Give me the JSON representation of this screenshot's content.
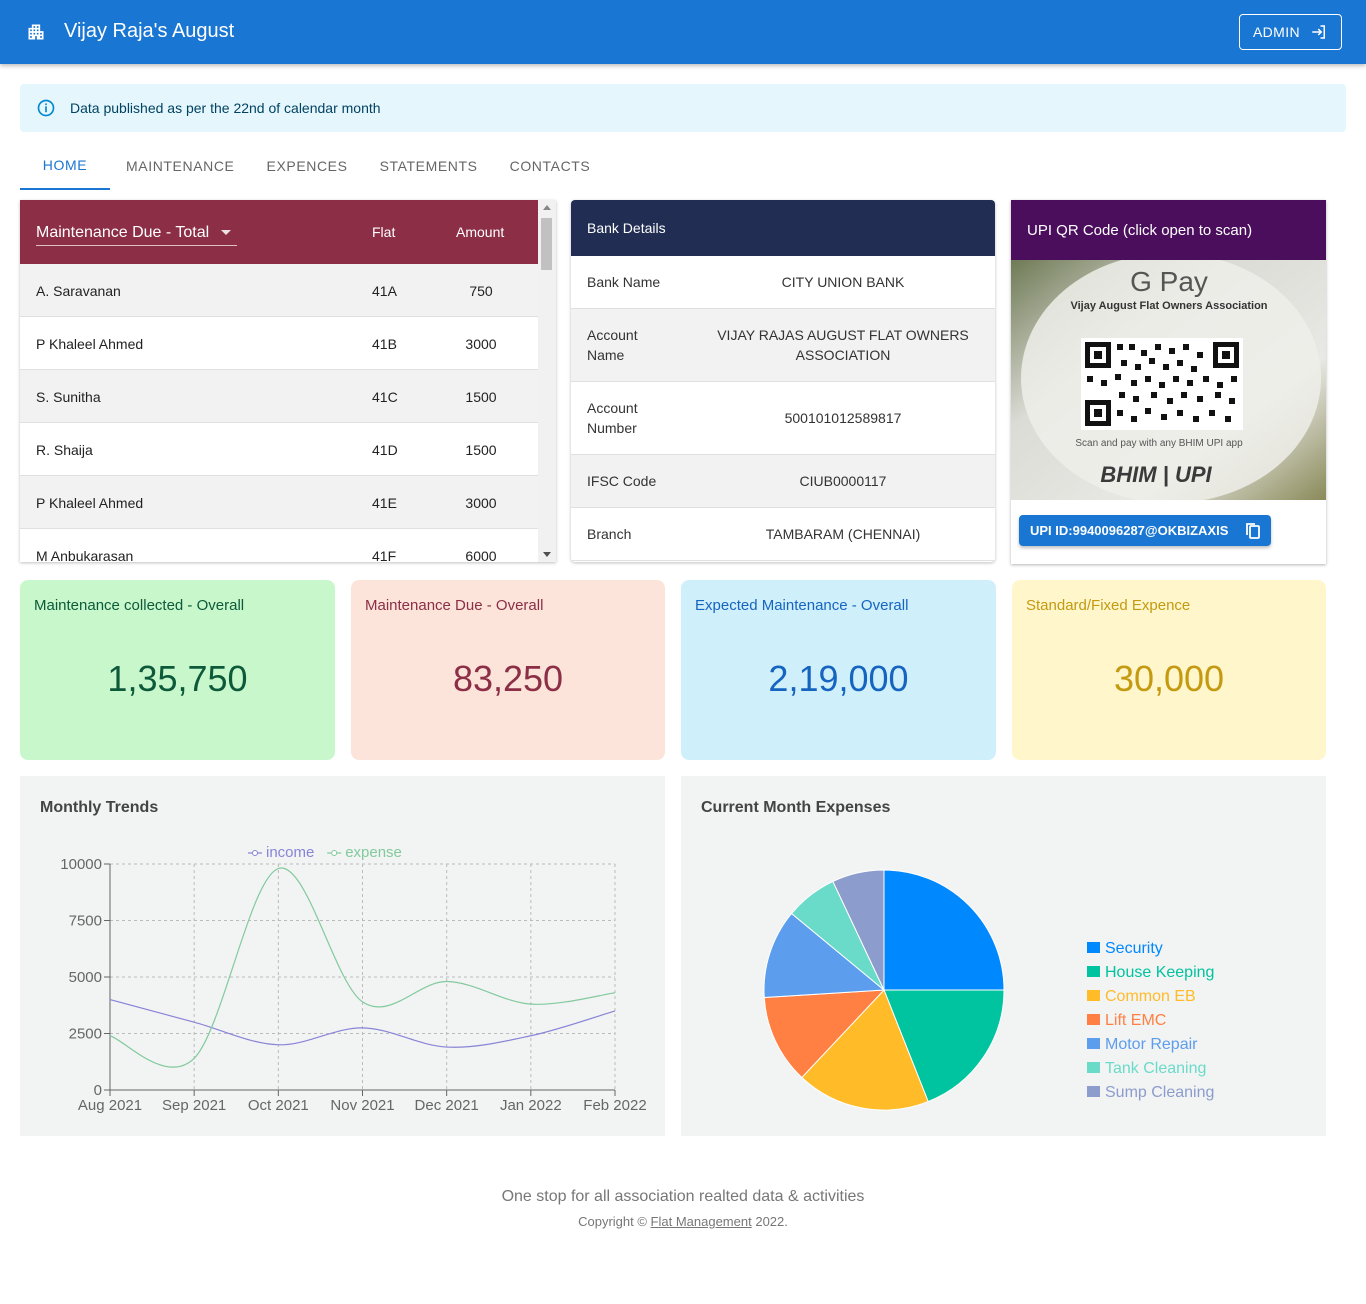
{
  "header": {
    "title": "Vijay Raja's August",
    "admin_label": "ADMIN"
  },
  "info": {
    "message": "Data published as per the 22nd of calendar month"
  },
  "tabs": [
    "HOME",
    "MAINTENANCE",
    "EXPENCES",
    "STATEMENTS",
    "CONTACTS"
  ],
  "due_table": {
    "selected": "Maintenance Due - Total",
    "col_flat": "Flat",
    "col_amount": "Amount",
    "rows": [
      {
        "name": "A. Saravanan",
        "flat": "41A",
        "amount": "750"
      },
      {
        "name": "P Khaleel Ahmed",
        "flat": "41B",
        "amount": "3000"
      },
      {
        "name": "S. Sunitha",
        "flat": "41C",
        "amount": "1500"
      },
      {
        "name": "R. Shaija",
        "flat": "41D",
        "amount": "1500"
      },
      {
        "name": "P Khaleel Ahmed",
        "flat": "41E",
        "amount": "3000"
      },
      {
        "name": "M Anbukarasan",
        "flat": "41F",
        "amount": "6000"
      }
    ]
  },
  "bank": {
    "title": "Bank Details",
    "rows": [
      {
        "key": "Bank Name",
        "value": "CITY UNION BANK"
      },
      {
        "key": "Account Name",
        "value": "VIJAY RAJAS AUGUST FLAT OWNERS ASSOCIATION"
      },
      {
        "key": "Account Number",
        "value": "500101012589817"
      },
      {
        "key": "IFSC Code",
        "value": "CIUB0000117"
      },
      {
        "key": "Branch",
        "value": "TAMBARAM (CHENNAI)"
      }
    ]
  },
  "upi": {
    "title": "UPI QR Code (click open to scan)",
    "button": "UPI ID:9940096287@OKBIZAXIS",
    "qr_brand": "G Pay",
    "qr_org": "Vijay August Flat Owners Association",
    "qr_caption": "Scan and pay with any BHIM UPI app",
    "qr_logo": "BHIM | UPI"
  },
  "stats": [
    {
      "label": "Maintenance collected - Overall",
      "value": "1,35,750",
      "bg": "#c8f7cc",
      "fg": "#0c5a3a"
    },
    {
      "label": "Maintenance Due - Overall",
      "value": "83,250",
      "bg": "#fde4da",
      "fg": "#8b2e46"
    },
    {
      "label": "Expected Maintenance - Overall",
      "value": "2,19,000",
      "bg": "#cfeffb",
      "fg": "#1565c0"
    },
    {
      "label": "Standard/Fixed Expence",
      "value": "30,000",
      "bg": "#fff6cc",
      "fg": "#c49a10"
    }
  ],
  "chart_data": [
    {
      "type": "line",
      "title": "Monthly Trends",
      "categories": [
        "Aug 2021",
        "Sep 2021",
        "Oct 2021",
        "Nov 2021",
        "Dec 2021",
        "Jan 2022",
        "Feb 2022"
      ],
      "series": [
        {
          "name": "income",
          "values": [
            4000,
            3000,
            2000,
            2750,
            1900,
            2400,
            3500
          ],
          "color": "#8884d8"
        },
        {
          "name": "expense",
          "values": [
            2400,
            1400,
            9800,
            3900,
            4800,
            3800,
            4300
          ],
          "color": "#82ca9d"
        }
      ],
      "ylim": [
        0,
        10000
      ],
      "yticks": [
        0,
        2500,
        5000,
        7500,
        10000
      ],
      "grid": true,
      "legend": "top"
    },
    {
      "type": "pie",
      "title": "Current Month Expenses",
      "categories": [
        "Security",
        "House Keeping",
        "Common EB",
        "Lift EMC",
        "Motor Repair",
        "Tank Cleaning",
        "Sump Cleaning"
      ],
      "values": [
        25,
        19,
        18,
        12,
        12,
        7,
        7
      ],
      "colors": [
        "#0088fe",
        "#00c49f",
        "#ffbb28",
        "#ff8042",
        "#5c9ded",
        "#6bdbc9",
        "#8c9ccc"
      ],
      "legend": "right"
    }
  ],
  "footer": {
    "line1": "One stop for all association realted data & activities",
    "copyright": "Copyright ©",
    "link": "Flat Management",
    "year": "2022."
  }
}
